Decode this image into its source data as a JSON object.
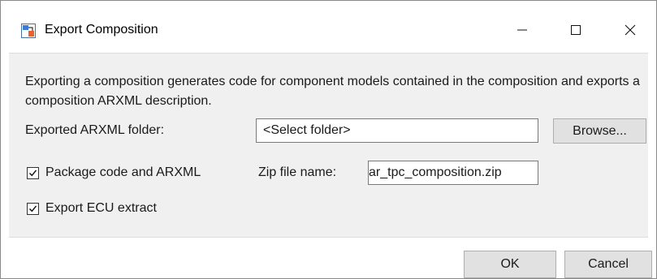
{
  "window": {
    "title": "Export Composition",
    "controls": {
      "minimize": "minimize",
      "maximize": "maximize",
      "close": "close"
    }
  },
  "content": {
    "description": "Exporting a composition generates code for component models contained in the composition and exports a composition ARXML description.",
    "folder_label": "Exported ARXML folder:",
    "folder_value": "<Select folder>",
    "browse_label": "Browse...",
    "package_checkbox": {
      "label": "Package code and ARXML",
      "checked": true
    },
    "zip_label": "Zip file name:",
    "zip_value": "ar_tpc_composition.zip",
    "ecu_checkbox": {
      "label": "Export ECU extract",
      "checked": true
    }
  },
  "footer": {
    "ok_label": "OK",
    "cancel_label": "Cancel"
  },
  "icons": [
    "app-icon",
    "minimize-icon",
    "maximize-icon",
    "close-icon",
    "checkmark-icon"
  ]
}
